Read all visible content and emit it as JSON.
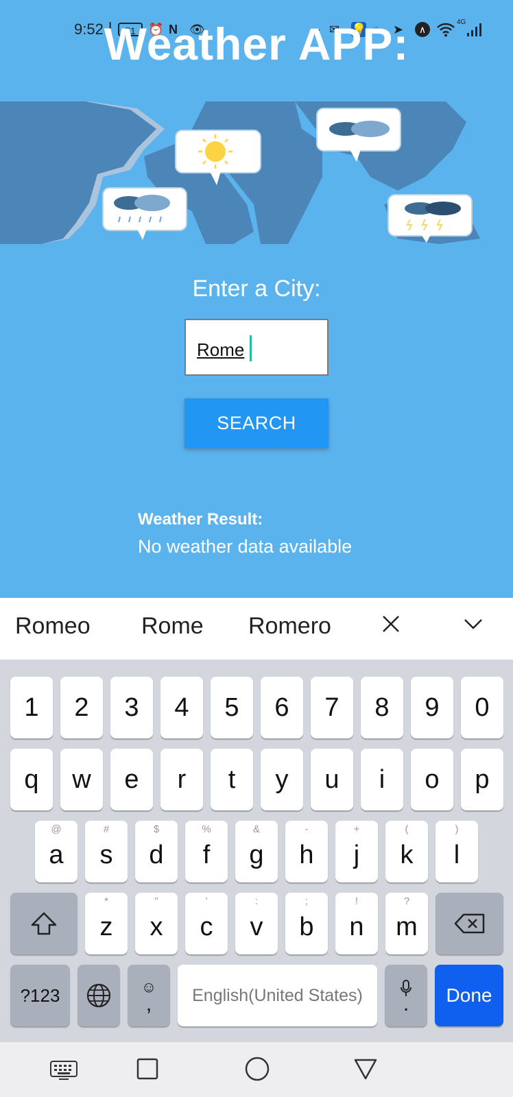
{
  "status_bar": {
    "time": "9:52",
    "battery": "71",
    "network": "4G"
  },
  "app": {
    "title": "Weather APP:",
    "city_label": "Enter a City:",
    "city_input_value": "Rome",
    "search_label": "SEARCH",
    "result_heading": "Weather Result:",
    "result_text": "No weather data available"
  },
  "suggestions": [
    "Romeo",
    "Rome",
    "Romero"
  ],
  "keyboard": {
    "numbers": [
      "1",
      "2",
      "3",
      "4",
      "5",
      "6",
      "7",
      "8",
      "9",
      "0"
    ],
    "row1": [
      "q",
      "w",
      "e",
      "r",
      "t",
      "y",
      "u",
      "i",
      "o",
      "p"
    ],
    "row2": [
      "a",
      "s",
      "d",
      "f",
      "g",
      "h",
      "j",
      "k",
      "l"
    ],
    "row2_hints": [
      "@",
      "#",
      "$",
      "%",
      "&",
      "-",
      "+",
      "(",
      ")"
    ],
    "row3": [
      "z",
      "x",
      "c",
      "v",
      "b",
      "n",
      "m"
    ],
    "row3_hints": [
      "*",
      "\"",
      "'",
      ":",
      ";",
      "!",
      "?"
    ],
    "symbols_label": "?123",
    "space_label": "English(United States)",
    "comma": ",",
    "period": ".",
    "done_label": "Done"
  },
  "colors": {
    "background": "#5bb3ee",
    "button": "#2196f3",
    "done": "#1060f0",
    "cursor": "#1fbfa8"
  }
}
